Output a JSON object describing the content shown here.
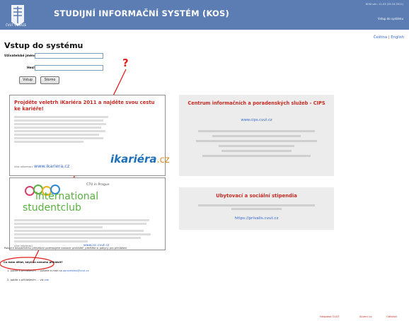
{
  "header": {
    "title": "STUDIJNÍ INFORMAČNÍ SYSTÉM (KOS)",
    "logo_caption": "ČVUT V PRAZE",
    "version": "KOSI ver.: 11.03 (29.10.2011)",
    "enter_link": "Vstup do systému"
  },
  "lang": {
    "cz": "Čeština",
    "sep": " | ",
    "en": "English"
  },
  "login": {
    "heading": "Vstup do systému",
    "user_label": "Uživatelské jméno",
    "pass_label": "Heslo",
    "submit": "Vstup",
    "cancel": "Storno"
  },
  "annotation": {
    "mark": "?",
    "color": "#e0201b"
  },
  "promo_ikariera": {
    "title": "Projděte veletrh iKariéra 2011 a najděte svou cestu ke kariéře!",
    "logo_left": "ikariéra",
    "logo_right": ".cz",
    "web_prefix": "Více informací:",
    "web": "www.ikariera.cz"
  },
  "promo_cips": {
    "title": "Centrum informačních a poradenských služeb - CIPS",
    "web": "www.cips.cvut.cz"
  },
  "promo_isc": {
    "logo_top": "CTU in Prague",
    "logo_1": "international",
    "logo_2": "studentclub",
    "web_prefix": "Více informací:",
    "web": "www.isc.cvut.cz"
  },
  "promo_ubyt": {
    "title": "Ubytovací a sociální stipendia",
    "web": "https://privalis.cvut.cz"
  },
  "notice": "Pokud k bezpečnému přihlášení potřebujete nastavit prohlížeč, přečtěte si pokyny pro přihlášení.",
  "problems": {
    "heading": "Co mám dělat, když se nemohu přihlásit?",
    "item1_prefix": "1. potíže s přihlášením ... pošlete e-mail na",
    "item1_link": "apraveskos@cvut.cz",
    "item2_prefix": "2. potíže s přihlášením ... viz",
    "item2_link": "zde"
  },
  "footer": {
    "link1": "Helpdesk ČVUT",
    "link2": "Alumni.cz",
    "link3": "Odhlásit"
  }
}
